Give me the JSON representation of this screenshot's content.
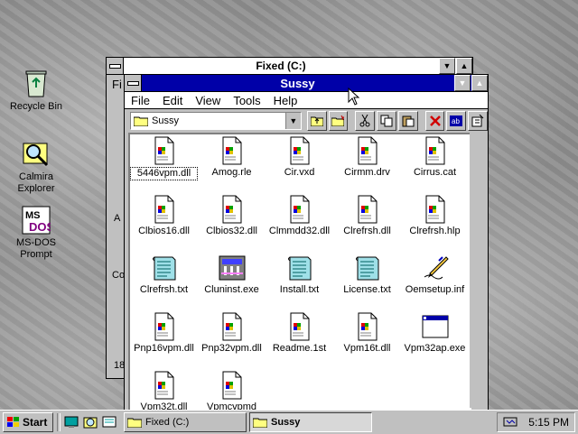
{
  "desktop": {
    "icons": [
      {
        "label": "Recycle Bin",
        "icon": "recycle-bin-icon"
      },
      {
        "label": "Calmira Explorer",
        "icon": "calmira-explorer-icon"
      },
      {
        "label": "MS-DOS Prompt",
        "icon": "ms-dos-icon"
      }
    ]
  },
  "back_window": {
    "title": "Fixed (C:)",
    "menu_initial": "Fi",
    "side_letters": [
      "A",
      "Co",
      "18"
    ]
  },
  "front_window": {
    "title": "Sussy",
    "menu": [
      "File",
      "Edit",
      "View",
      "Tools",
      "Help"
    ],
    "address": "Sussy",
    "files": [
      {
        "name": "5446vpm.dll",
        "type": "dll"
      },
      {
        "name": "Amog.rle",
        "type": "dll"
      },
      {
        "name": "Cir.vxd",
        "type": "dll"
      },
      {
        "name": "Cirmm.drv",
        "type": "dll"
      },
      {
        "name": "Cirrus.cat",
        "type": "dll"
      },
      {
        "name": "Clbios16.dll",
        "type": "dll"
      },
      {
        "name": "Clbios32.dll",
        "type": "dll"
      },
      {
        "name": "Clmmdd32.dll",
        "type": "dll"
      },
      {
        "name": "Clrefrsh.dll",
        "type": "dll"
      },
      {
        "name": "Clrefrsh.hlp",
        "type": "dll"
      },
      {
        "name": "Clrefrsh.txt",
        "type": "txt"
      },
      {
        "name": "Cluninst.exe",
        "type": "exe-installer"
      },
      {
        "name": "Install.txt",
        "type": "txt"
      },
      {
        "name": "License.txt",
        "type": "txt"
      },
      {
        "name": "Oemsetup.inf",
        "type": "inf"
      },
      {
        "name": "Pnp16vpm.dll",
        "type": "dll"
      },
      {
        "name": "Pnp32vpm.dll",
        "type": "dll"
      },
      {
        "name": "Readme.1st",
        "type": "dll"
      },
      {
        "name": "Vpm16t.dll",
        "type": "dll"
      },
      {
        "name": "Vpm32ap.exe",
        "type": "exe-window"
      },
      {
        "name": "Vpm32t.dll",
        "type": "dll"
      },
      {
        "name": "Vpmcvpmd",
        "type": "dll"
      }
    ]
  },
  "taskbar": {
    "start_label": "Start",
    "tasks": [
      {
        "label": "Fixed (C:)"
      },
      {
        "label": "Sussy"
      }
    ],
    "clock": "5:15 PM"
  },
  "colors": {
    "title_active": "#0000a8",
    "face": "#c0c0c0"
  }
}
